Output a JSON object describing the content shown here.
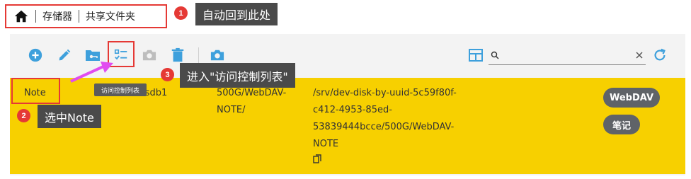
{
  "breadcrumb": {
    "home_icon": "home-icon",
    "items": [
      "存储器",
      "共享文件夹"
    ]
  },
  "callouts": {
    "c1": {
      "number": "1",
      "text": "自动回到此处"
    },
    "c2": {
      "number": "2",
      "text": "选中Note"
    },
    "c3": {
      "number": "3",
      "text": "进入\"访问控制列表\""
    }
  },
  "toolbar": {
    "icons": [
      "add-circle-icon",
      "edit-pencil-icon",
      "folder-key-icon",
      "acl-checklist-icon",
      "camera-icon",
      "delete-trash-icon",
      "snapshot-camera-icon"
    ],
    "tooltip": "访问控制列表",
    "search_placeholder": "",
    "accent_color": "#3ea0dc"
  },
  "table": {
    "row": {
      "name": "Note",
      "device": "/dev/sdb1",
      "relative_path": [
        "500G/WebDAV-",
        "NOTE/"
      ],
      "absolute_path": [
        "/srv/dev-disk-by-uuid-5c59f80f-",
        "c412-4953-85ed-",
        "53839444bcce/500G/WebDAV-",
        "NOTE"
      ],
      "tags": [
        "WebDAV",
        "笔记"
      ]
    },
    "row_color": "#f7d000"
  }
}
